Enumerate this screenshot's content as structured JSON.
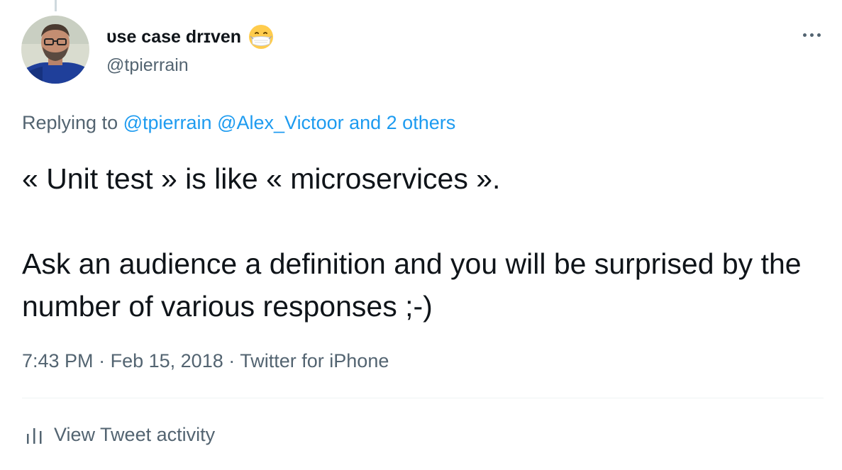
{
  "author": {
    "display_name": "ᴜse case drɪven",
    "handle": "@tpierrain",
    "status_emoji": "face-with-medical-mask-icon"
  },
  "reply": {
    "prefix": "Replying to",
    "mentions": [
      "@tpierrain",
      "@Alex_Victoor"
    ],
    "others": "and 2 others"
  },
  "tweet": {
    "line1": "« Unit test » is like « microservices ».",
    "line2": "Ask an audience a definition and you will be surprised by the number of various responses ;-)"
  },
  "meta": {
    "time": "7:43 PM",
    "separator": "·",
    "date": "Feb 15, 2018",
    "source": "Twitter for iPhone"
  },
  "activity": {
    "label": "View Tweet activity",
    "icon": "bar-chart-icon"
  },
  "more": {
    "icon": "more-dots-icon"
  },
  "colors": {
    "link": "#1d9bf0",
    "secondary_text": "#536471",
    "primary_text": "#0f1419"
  }
}
